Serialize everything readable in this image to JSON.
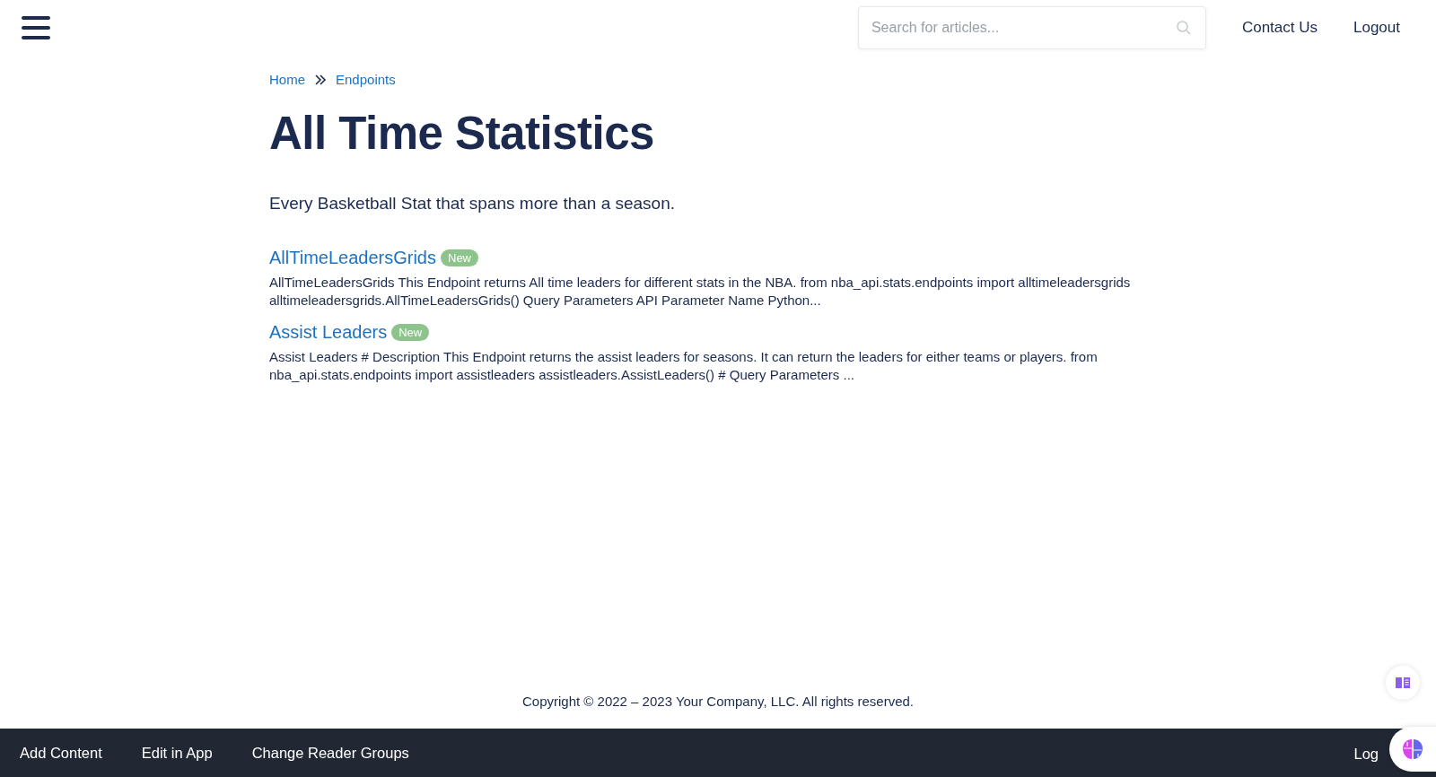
{
  "header": {
    "search": {
      "placeholder": "Search for articles..."
    },
    "links": [
      "Contact Us",
      "Logout"
    ]
  },
  "breadcrumb": [
    "Home",
    "Endpoints"
  ],
  "title": "All Time Statistics",
  "description": "Every Basketball Stat that spans more than a season.",
  "articles": [
    {
      "title": "AllTimeLeadersGrids",
      "badge": "New",
      "excerpt": "AllTimeLeadersGrids This Endpoint returns All time leaders for different stats in the NBA. from nba_api.stats.endpoints import alltimeleadersgrids alltimeleadersgrids.AllTimeLeadersGrids() Query Parameters API Parameter Name Python..."
    },
    {
      "title": "Assist Leaders",
      "badge": "New",
      "excerpt": "Assist Leaders # Description This Endpoint returns the assist leaders for seasons. It can return the leaders for either teams or players. from nba_api.stats.endpoints import assistleaders assistleaders.AssistLeaders() # Query Parameters ..."
    }
  ],
  "copyright": "Copyright © 2022 – 2023 Your Company, LLC. All rights reserved.",
  "bottom_bar": {
    "items": [
      "Add Content",
      "Edit in App",
      "Change Reader Groups"
    ],
    "cut_item": "Log"
  }
}
